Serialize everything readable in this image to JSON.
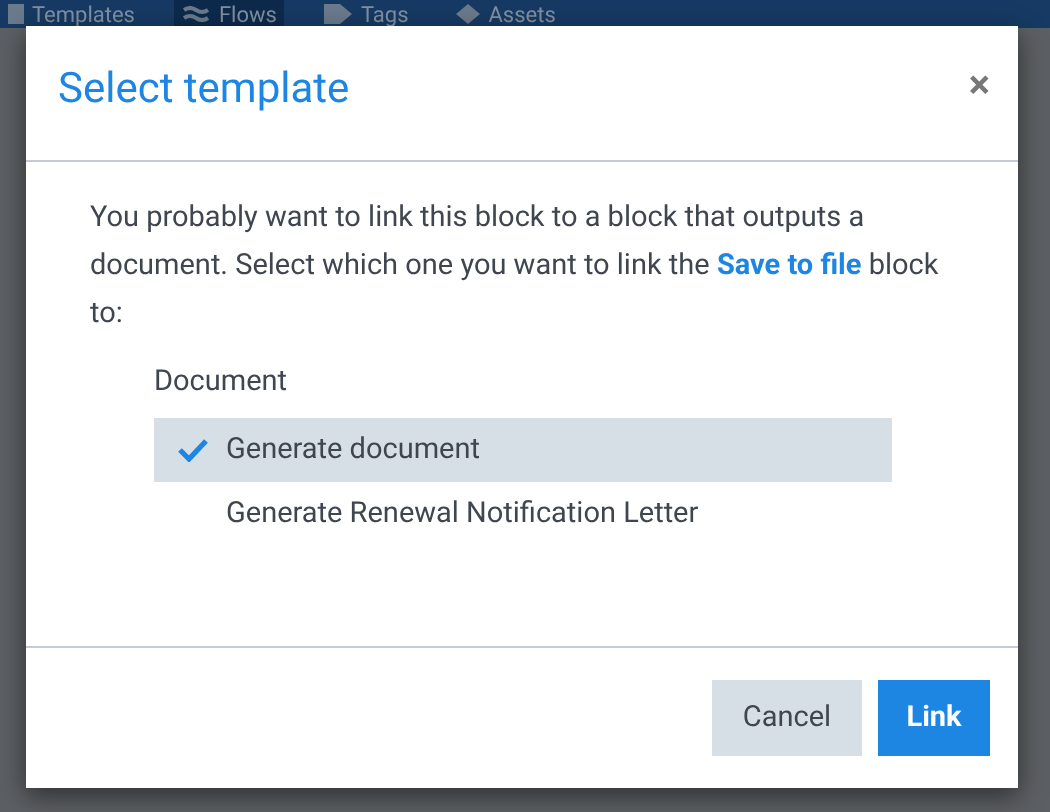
{
  "background_nav": [
    {
      "label": "Templates",
      "selected": false
    },
    {
      "label": "Flows",
      "selected": true
    },
    {
      "label": "Tags",
      "selected": false
    },
    {
      "label": "Assets",
      "selected": false
    }
  ],
  "dialog": {
    "title": "Select template",
    "close": "×",
    "message": "You probably want to link this block to a block that outputs a document. Select which one you want to link the **Save to file** block to:",
    "group_label": "Document",
    "options": [
      {
        "label": "Generate document",
        "selected": true
      },
      {
        "label": "Generate Renewal Notification Letter",
        "selected": false
      }
    ],
    "buttons": [
      {
        "label": "Cancel",
        "kind": "secondary"
      },
      {
        "label": "Link",
        "kind": "primary"
      }
    ]
  }
}
